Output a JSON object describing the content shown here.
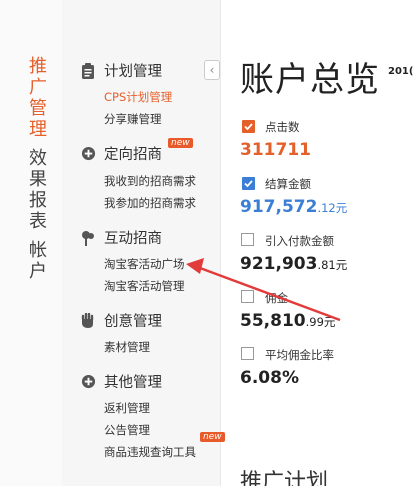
{
  "left_nav": {
    "promotion_report": [
      "推",
      "广",
      "管",
      "理"
    ],
    "effect_report": [
      "效",
      "果",
      "报",
      "表"
    ],
    "account": [
      "帐",
      "户"
    ]
  },
  "menu": {
    "collapse_icon": "‹",
    "plan": {
      "title": "计划管理",
      "items": [
        "CPS计划管理",
        "分享赚管理"
      ]
    },
    "targeted": {
      "title": "定向招商",
      "badge": "new",
      "items": [
        "我收到的招商需求",
        "我参加的招商需求"
      ]
    },
    "interactive": {
      "title": "互动招商",
      "items": [
        "淘宝客活动广场",
        "淘宝客活动管理"
      ]
    },
    "creative": {
      "title": "创意管理",
      "items": [
        "素材管理"
      ]
    },
    "other": {
      "title": "其他管理",
      "items": [
        "返利管理",
        "公告管理",
        "商品违规查询工具"
      ],
      "badge": "new"
    }
  },
  "main": {
    "title": "账户总览",
    "date": "201(",
    "metrics": [
      {
        "label": "点击数",
        "checked": true,
        "value": "311711",
        "small": ""
      },
      {
        "label": "结算金额",
        "checked": true,
        "value": "917,572",
        "small": ".12元"
      },
      {
        "label": "引入付款金额",
        "checked": false,
        "value": "921,903",
        "small": ".81元"
      },
      {
        "label": "佣金",
        "checked": false,
        "value": "55,810",
        "small": ".99元"
      },
      {
        "label": "平均佣金比率",
        "checked": false,
        "value": "6.08%",
        "small": ""
      }
    ],
    "bottom_clipped": "推广计划"
  },
  "colors": {
    "accent": "#e4602b",
    "blue": "#3a7fd5",
    "arrow": "#e23b3b"
  }
}
